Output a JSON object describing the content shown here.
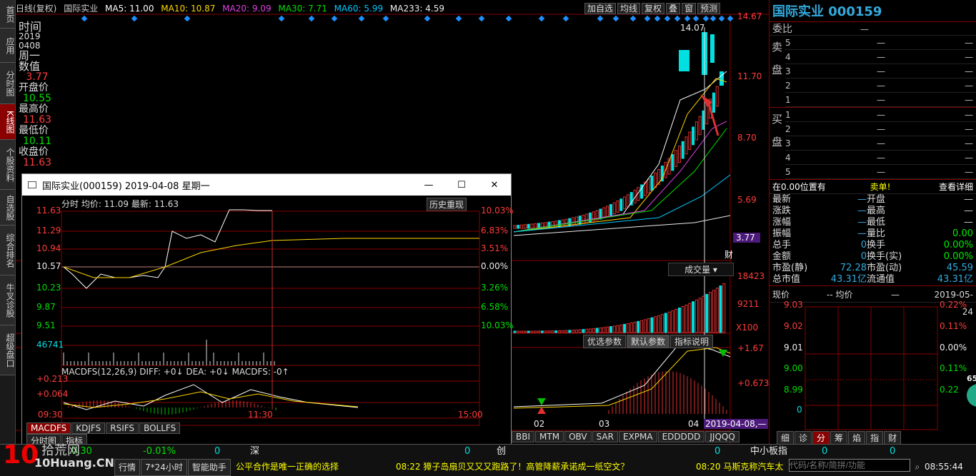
{
  "nav": [
    "首页",
    "应用",
    "分时图",
    "K线图",
    "个股资料",
    "自选股",
    "综合排名",
    "牛叉诊股",
    "超级盘口"
  ],
  "topbar": {
    "period": "日线(复权)",
    "name": "国际实业",
    "ma5": "MA5: 11.00",
    "ma10": "MA10: 10.87",
    "ma20": "MA20: 9.09",
    "ma30": "MA30: 7.71",
    "ma60": "MA60: 5.99",
    "ma233": "MA233: 4.59",
    "buttons": [
      "加自选",
      "均线",
      "复权",
      "叠",
      "窗",
      "预测"
    ]
  },
  "info": {
    "time_label": "时间",
    "date1": "2019",
    "date2": "0408",
    "weekday": "周一",
    "num_label": "数值",
    "num_value": "3.77",
    "open_label": "开盘价",
    "open_value": "10.55",
    "high_label": "最高价",
    "high_value": "11.63",
    "low_label": "最低价",
    "low_value": "10.11",
    "close_label": "收盘价",
    "close_value": "11.63"
  },
  "price_axis": [
    "14.67",
    "11.70",
    "8.70",
    "5.69",
    "3.77"
  ],
  "price_peak": "14.07",
  "fin_badge": "财",
  "volume": {
    "label": "成交量",
    "axis": [
      "18423",
      "9211",
      "X100"
    ]
  },
  "macd_main": {
    "axis": [
      "+1.67",
      "+0.673"
    ],
    "tabs": [
      "优选参数",
      "默认参数",
      "指标说明"
    ]
  },
  "time_axis": [
    "02",
    "03",
    "04"
  ],
  "cursor_date": "2019-04-08,—",
  "indicator_tabs": [
    "BBI",
    "MTM",
    "OBV",
    "SAR",
    "EXPMA",
    "EDDDDD",
    "JJQQQ"
  ],
  "right": {
    "title": "国际实业 000159",
    "weibi": "委比",
    "weibi_val": "—",
    "sell_label": "卖\n盘",
    "buy_label": "买\n盘",
    "sell_levels": [
      "5",
      "4",
      "3",
      "2",
      "1"
    ],
    "buy_levels": [
      "1",
      "2",
      "3",
      "4",
      "5"
    ],
    "dash": "—",
    "pos_text": "在0.00位置有",
    "sell1": "卖单!",
    "detail": "查看详细",
    "stats": [
      [
        "最新",
        "—",
        "开盘",
        "—"
      ],
      [
        "涨跌",
        "—",
        "最高",
        "—"
      ],
      [
        "涨幅",
        "—",
        "最低",
        "—"
      ],
      [
        "振幅",
        "—",
        "量比",
        "0.00"
      ],
      [
        "总手",
        "0",
        "换手",
        "0.00%"
      ],
      [
        "金额",
        "0",
        "换手(实)",
        "0.00%"
      ],
      [
        "市盈(静)",
        "72.28",
        "市盈(动)",
        "45.59"
      ],
      [
        "总市值",
        "43.31亿",
        "流通值",
        "43.31亿"
      ]
    ],
    "price_line": {
      "label": "现价",
      "avg": "-- 均价",
      "dash": "—",
      "date": "2019-05-24"
    },
    "mini_axis_left": [
      "9.03",
      "9.02",
      "9.01",
      "9.00",
      "8.99",
      "0"
    ],
    "mini_axis_right": [
      "0.22%",
      "0.11%",
      "0.00%",
      "0.11%",
      "0.22"
    ],
    "bottom_tabs": [
      "细",
      "诊",
      "分",
      "筹",
      "焰",
      "指",
      "财"
    ],
    "circle_val": "65"
  },
  "popup": {
    "title": "国际实业(000159) 2019-04-08 星期一",
    "header": "分时 均价: 11.09 最新: 11.63",
    "replay": "历史重现",
    "left_axis": [
      "11.63",
      "11.29",
      "10.94",
      "10.57",
      "10.23",
      "9.87",
      "9.51",
      "46741"
    ],
    "right_axis": [
      "10.03%",
      "6.83%",
      "3.51%",
      "0.00%",
      "3.26%",
      "6.58%",
      "10.03%"
    ],
    "macd_label": "MACDFS(12,26,9) DIFF: +0↓ DEA: +0↓ MACDFS: -0↑",
    "macd_axis": [
      "+0.213",
      "+0.064"
    ],
    "time": [
      "09:30",
      "11:30",
      "15:00"
    ],
    "tabs": [
      "MACDFS",
      "KDJFS",
      "RSIFS",
      "BOLLFS"
    ],
    "bottom_tabs": [
      "分时图",
      "指标"
    ]
  },
  "bottom": {
    "row1": [
      "0.30",
      "-0.01%",
      "0",
      "深",
      "0",
      "创",
      "0",
      "中小板指",
      "0",
      "0"
    ],
    "row2": [
      "行情",
      "7*24小时",
      "智能助手"
    ],
    "news1": "公平合作是唯一正确的选择",
    "news2": "08:22 獐子岛扇贝又又又跑路了！高管降薪承诺成一纸空文？",
    "news3": "08:20 马斯克称汽车太",
    "search_placeholder": "代码/名称/简拼/功能",
    "clock": "08:55:44",
    "logo": "拾荒网",
    "logo2": "10Huang.CN"
  }
}
